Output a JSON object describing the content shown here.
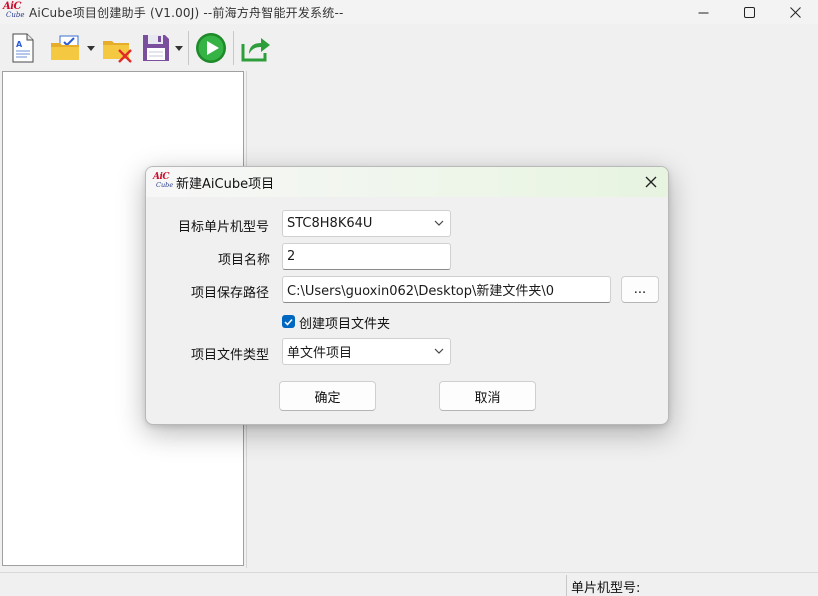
{
  "window": {
    "title": "AiCube项目创建助手 (V1.00J) --前海方舟智能开发系统--",
    "logo_aic": "AiC",
    "logo_cube": "Cube"
  },
  "toolbar": {
    "items": [
      "new-document-icon",
      "open-project-icon",
      "close-project-icon",
      "save-icon",
      "run-icon",
      "export-icon"
    ]
  },
  "statusbar": {
    "mcu_label": "单片机型号:"
  },
  "dialog": {
    "title": "新建AiCube项目",
    "mcu_label": "目标单片机型号",
    "mcu_value": "STC8H8K64U",
    "name_label": "项目名称",
    "name_value": "2",
    "path_label": "项目保存路径",
    "path_value": "C:\\Users\\guoxin062\\Desktop\\新建文件夹\\0",
    "browse_label": "...",
    "create_folder_label": "创建项目文件夹",
    "create_folder_checked": true,
    "filetype_label": "项目文件类型",
    "filetype_value": "单文件项目",
    "ok_label": "确定",
    "cancel_label": "取消"
  },
  "colors": {
    "accent": "#0067c0",
    "run_green": "#1e9e2f",
    "folder_yellow": "#f2c23a",
    "save_purple": "#7a4f9e"
  }
}
